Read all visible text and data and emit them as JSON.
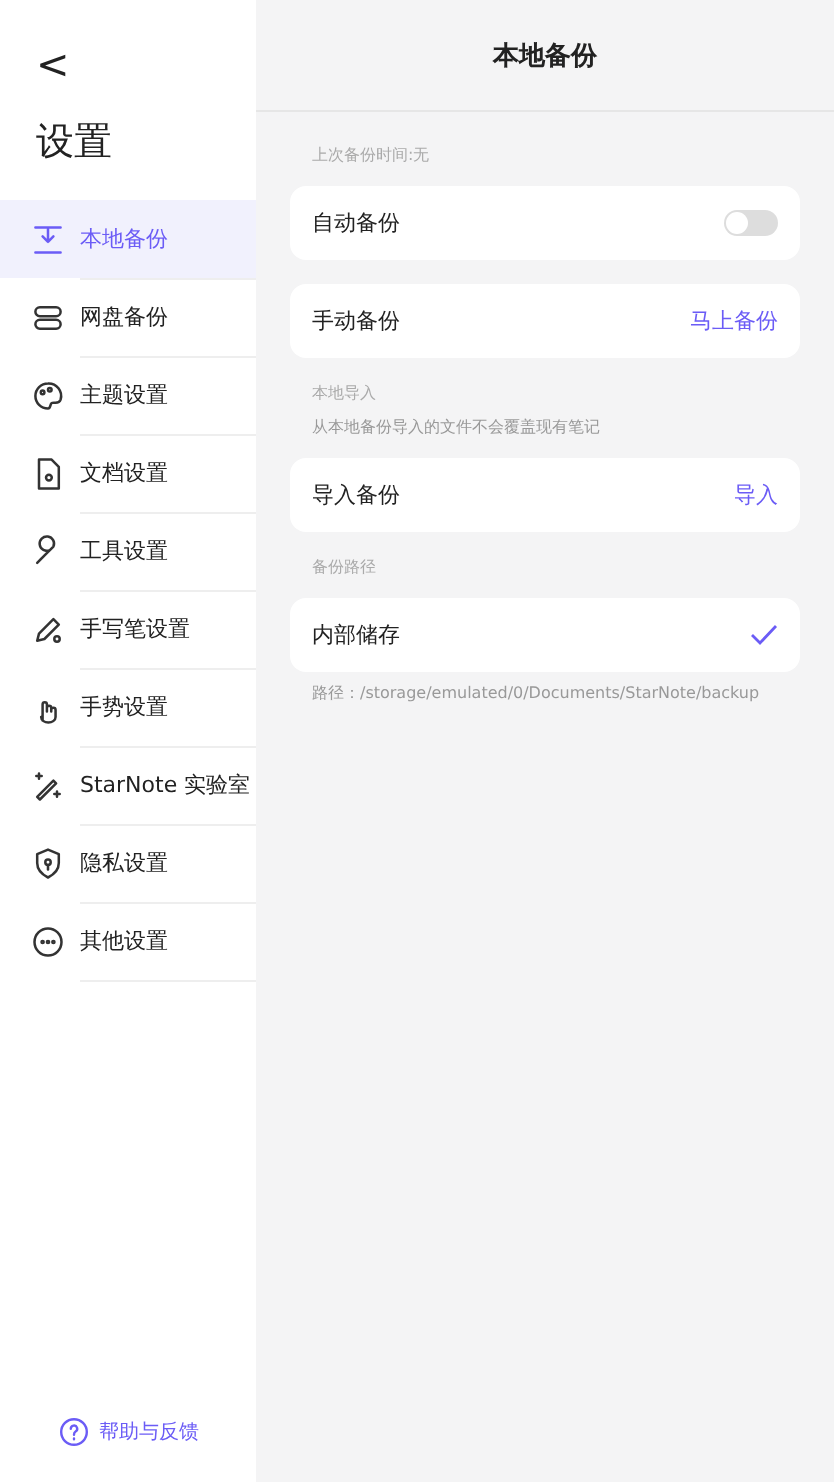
{
  "sidebar": {
    "back": "<",
    "title": "设置",
    "items": [
      {
        "label": "本地备份",
        "selected": true
      },
      {
        "label": "网盘备份",
        "selected": false
      },
      {
        "label": "主题设置",
        "selected": false
      },
      {
        "label": "文档设置",
        "selected": false
      },
      {
        "label": "工具设置",
        "selected": false
      },
      {
        "label": "手写笔设置",
        "selected": false
      },
      {
        "label": "手势设置",
        "selected": false
      },
      {
        "label": "StarNote 实验室",
        "selected": false
      },
      {
        "label": "隐私设置",
        "selected": false
      },
      {
        "label": "其他设置",
        "selected": false
      }
    ],
    "help": "帮助与反馈"
  },
  "page": {
    "title": "本地备份",
    "sections": [
      {
        "heading": "上次备份时间:无",
        "rows": [
          {
            "kind": "toggle",
            "label": "自动备份",
            "on": false
          },
          {
            "kind": "action",
            "label": "手动备份",
            "action": "马上备份"
          }
        ]
      },
      {
        "heading": "本地导入",
        "note": "从本地备份导入的文件不会覆盖现有笔记",
        "rows": [
          {
            "kind": "action",
            "label": "导入备份",
            "action": "导入"
          }
        ]
      },
      {
        "heading": "备份路径",
        "rows": [
          {
            "kind": "check",
            "label": "内部储存",
            "selected": true
          }
        ],
        "footer": "路径：/storage/emulated/0/Documents/StarNote/backup"
      }
    ]
  }
}
